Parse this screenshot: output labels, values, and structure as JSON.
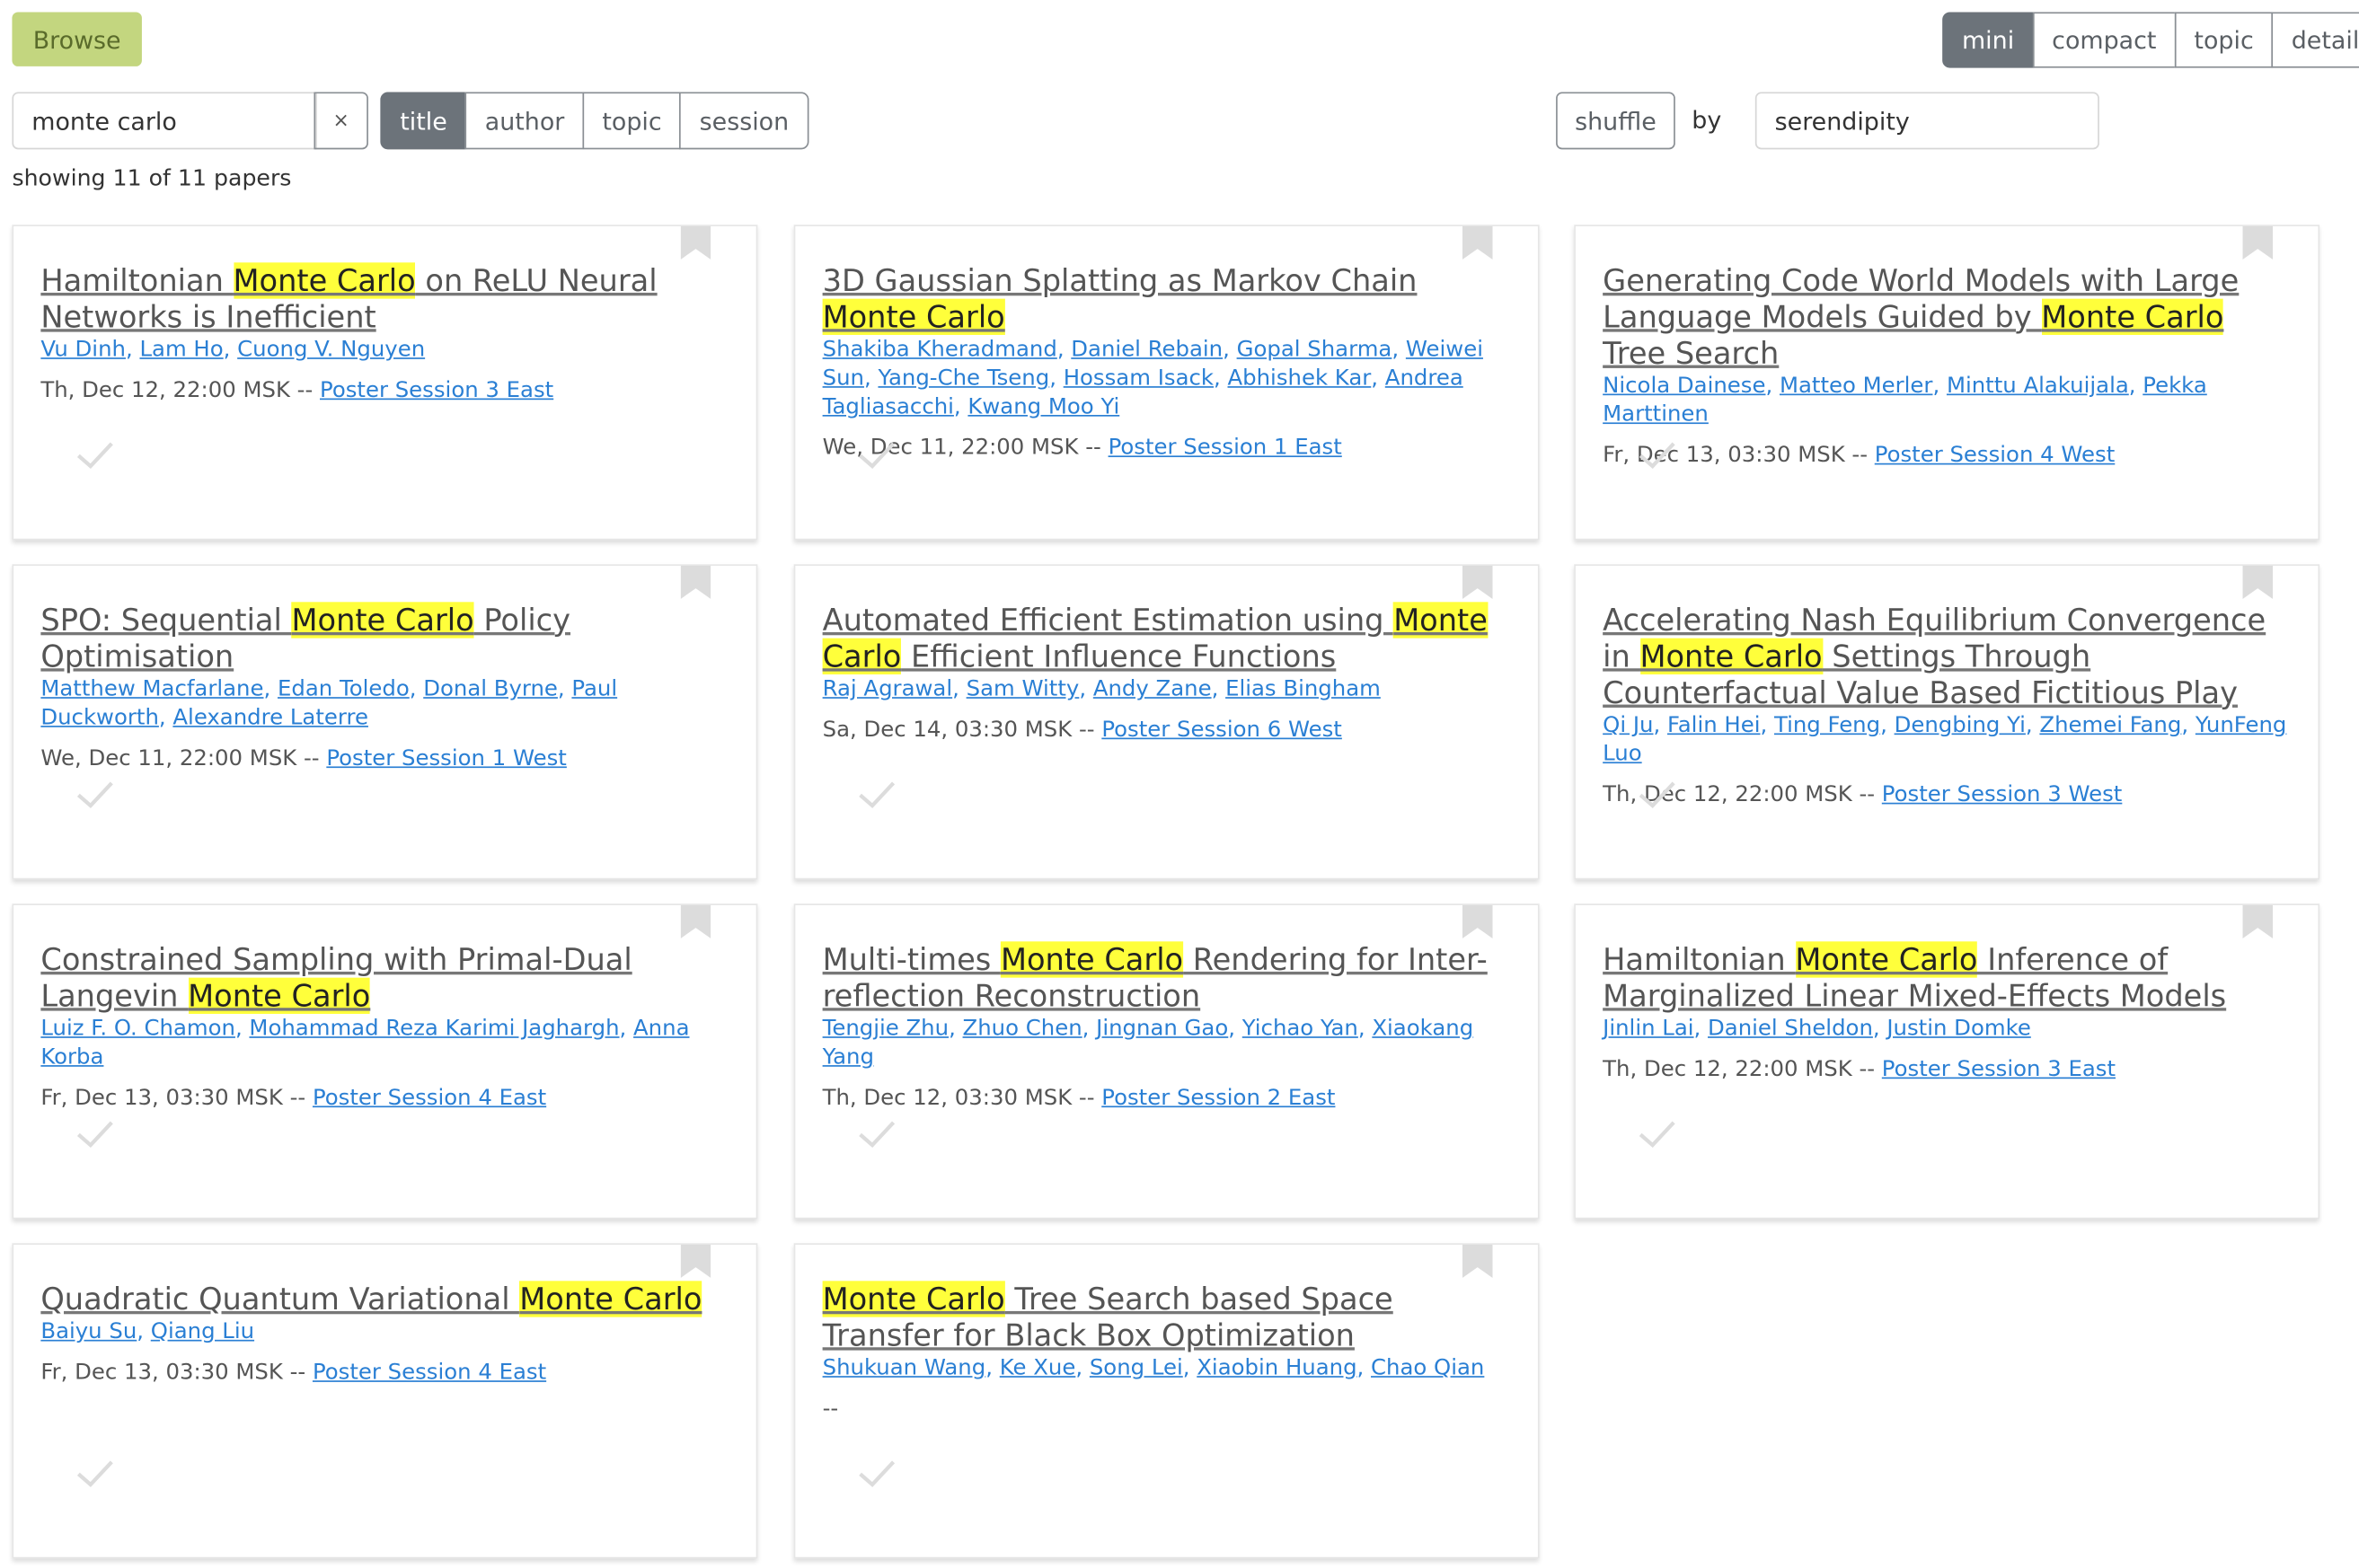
{
  "nav": {
    "browse_label": "Browse"
  },
  "view_modes": [
    {
      "label": "mini",
      "active": true
    },
    {
      "label": "compact",
      "active": false
    },
    {
      "label": "topic",
      "active": false
    },
    {
      "label": "detail",
      "active": false
    }
  ],
  "search": {
    "value": "monte carlo",
    "clear_label": "×"
  },
  "filters": [
    {
      "label": "title",
      "active": true
    },
    {
      "label": "author",
      "active": false
    },
    {
      "label": "topic",
      "active": false
    },
    {
      "label": "session",
      "active": false
    }
  ],
  "sort": {
    "shuffle_label": "shuffle",
    "by_label": "by",
    "value": "serendipity"
  },
  "count_text": "showing 11 of 11 papers",
  "papers": [
    {
      "title_parts": [
        {
          "t": "Hamiltonian "
        },
        {
          "t": "Monte Carlo",
          "hl": true
        },
        {
          "t": " on ReLU Neural Networks is Inefficient"
        }
      ],
      "authors": [
        "Vu Dinh",
        "Lam Ho",
        "Cuong V. Nguyen"
      ],
      "time": "Th, Dec 12, 22:00 MSK -- ",
      "session": "Poster Session 3 East"
    },
    {
      "title_parts": [
        {
          "t": "3D Gaussian Splatting as Markov Chain "
        },
        {
          "t": "Monte Carlo",
          "hl": true
        }
      ],
      "authors": [
        "Shakiba Kheradmand",
        "Daniel Rebain",
        "Gopal Sharma",
        "Weiwei Sun",
        "Yang-Che Tseng",
        "Hossam Isack",
        "Abhishek Kar",
        "Andrea Tagliasacchi",
        "Kwang Moo Yi"
      ],
      "time": "We, Dec 11, 22:00 MSK -- ",
      "session": "Poster Session 1 East"
    },
    {
      "title_parts": [
        {
          "t": "Generating Code World Models with Large Language Models Guided by "
        },
        {
          "t": "Monte Carlo",
          "hl": true
        },
        {
          "t": " Tree Search"
        }
      ],
      "authors": [
        "Nicola Dainese",
        "Matteo Merler",
        "Minttu Alakuijala",
        "Pekka Marttinen"
      ],
      "time": "Fr, Dec 13, 03:30 MSK -- ",
      "session": "Poster Session 4 West"
    },
    {
      "title_parts": [
        {
          "t": "SPO: Sequential "
        },
        {
          "t": "Monte Carlo",
          "hl": true
        },
        {
          "t": " Policy Optimisation"
        }
      ],
      "authors": [
        "Matthew Macfarlane",
        "Edan Toledo",
        "Donal Byrne",
        "Paul Duckworth",
        "Alexandre Laterre"
      ],
      "time": "We, Dec 11, 22:00 MSK -- ",
      "session": "Poster Session 1 West"
    },
    {
      "title_parts": [
        {
          "t": "Automated Efficient Estimation using "
        },
        {
          "t": "Monte Carlo",
          "hl": true
        },
        {
          "t": " Efficient Influence Functions"
        }
      ],
      "authors": [
        "Raj Agrawal",
        "Sam Witty",
        "Andy Zane",
        "Elias Bingham"
      ],
      "time": "Sa, Dec 14, 03:30 MSK -- ",
      "session": "Poster Session 6 West"
    },
    {
      "title_parts": [
        {
          "t": "Accelerating Nash Equilibrium Convergence in "
        },
        {
          "t": "Monte Carlo",
          "hl": true
        },
        {
          "t": " Settings Through Counterfactual Value Based Fictitious Play"
        }
      ],
      "authors": [
        "Qi Ju",
        "Falin Hei",
        "Ting Feng",
        "Dengbing Yi",
        "Zhemei Fang",
        "YunFeng Luo"
      ],
      "time": "Th, Dec 12, 22:00 MSK -- ",
      "session": "Poster Session 3 West"
    },
    {
      "title_parts": [
        {
          "t": "Constrained Sampling with Primal-Dual Langevin "
        },
        {
          "t": "Monte Carlo",
          "hl": true
        }
      ],
      "authors": [
        "Luiz F. O. Chamon",
        "Mohammad Reza Karimi Jaghargh",
        "Anna Korba"
      ],
      "time": "Fr, Dec 13, 03:30 MSK -- ",
      "session": "Poster Session 4 East"
    },
    {
      "title_parts": [
        {
          "t": "Multi-times "
        },
        {
          "t": "Monte Carlo",
          "hl": true
        },
        {
          "t": " Rendering for Inter-reflection Reconstruction"
        }
      ],
      "authors": [
        "Tengjie Zhu",
        "Zhuo Chen",
        "Jingnan Gao",
        "Yichao Yan",
        "Xiaokang Yang"
      ],
      "time": "Th, Dec 12, 03:30 MSK -- ",
      "session": "Poster Session 2 East"
    },
    {
      "title_parts": [
        {
          "t": "Hamiltonian "
        },
        {
          "t": "Monte Carlo",
          "hl": true
        },
        {
          "t": " Inference of Marginalized Linear Mixed-Effects Models"
        }
      ],
      "authors": [
        "Jinlin Lai",
        "Daniel Sheldon",
        "Justin Domke"
      ],
      "time": "Th, Dec 12, 22:00 MSK -- ",
      "session": "Poster Session 3 East"
    },
    {
      "title_parts": [
        {
          "t": "Quadratic Quantum Variational "
        },
        {
          "t": "Monte Carlo",
          "hl": true
        }
      ],
      "authors": [
        "Baiyu Su",
        "Qiang Liu"
      ],
      "time": "Fr, Dec 13, 03:30 MSK -- ",
      "session": "Poster Session 4 East"
    },
    {
      "title_parts": [
        {
          "t": "Monte Carlo",
          "hl": true
        },
        {
          "t": " Tree Search based Space Transfer for Black Box Optimization"
        }
      ],
      "authors": [
        "Shukuan Wang",
        "Ke Xue",
        "Song Lei",
        "Xiaobin Huang",
        "Chao Qian"
      ],
      "time": "--",
      "session": ""
    }
  ]
}
